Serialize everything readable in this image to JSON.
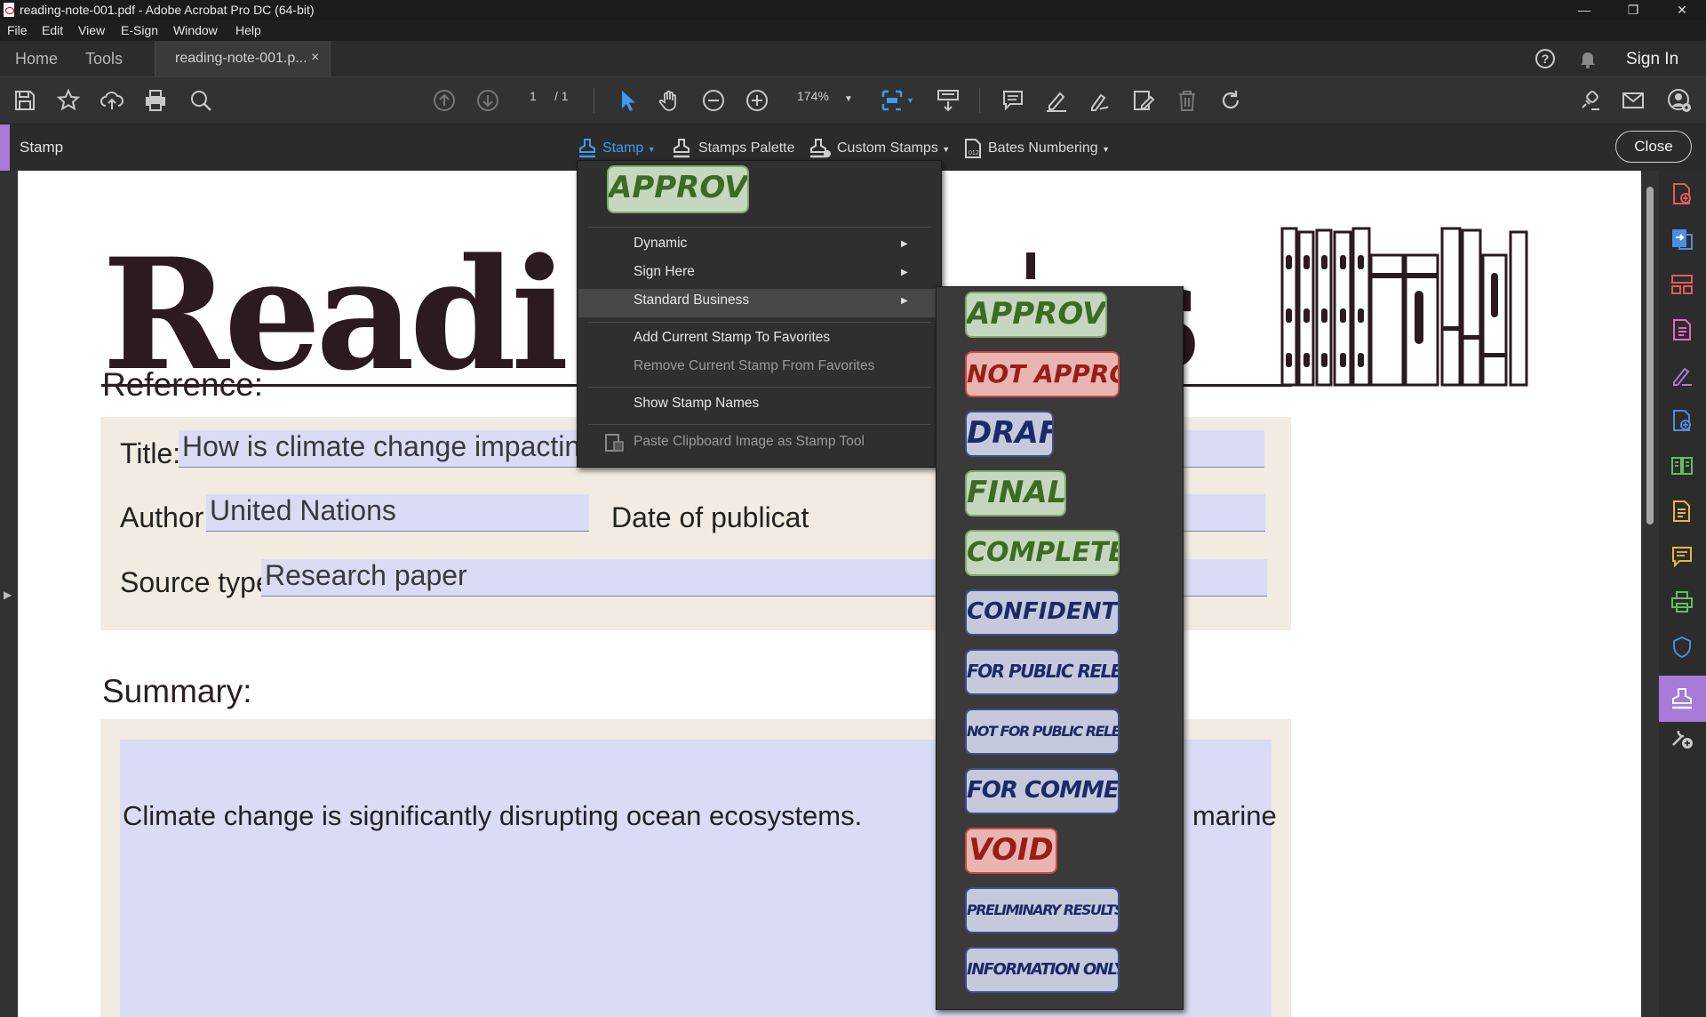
{
  "window": {
    "title": "reading-note-001.pdf - Adobe Acrobat Pro DC (64-bit)",
    "minimize": "—",
    "restore": "❐",
    "close": "✕"
  },
  "menubar": [
    "File",
    "Edit",
    "View",
    "E-Sign",
    "Window",
    "Help"
  ],
  "tabs": {
    "home": "Home",
    "tools": "Tools",
    "document": "reading-note-001.p...",
    "document_close": "×",
    "sign_in": "Sign In"
  },
  "toolbar": {
    "page_current": "1",
    "page_total": "/ 1",
    "zoom": "174%"
  },
  "stampbar": {
    "panel_name": "Stamp",
    "stamp_menu": "Stamp",
    "stamps_palette": "Stamps Palette",
    "custom_stamps": "Custom Stamps",
    "bates_numbering": "Bates Numbering",
    "close": "Close"
  },
  "stamp_menu": {
    "preview_stamp": "APPROVED",
    "items": [
      "Dynamic",
      "Sign Here",
      "Standard Business",
      "Add Current Stamp To Favorites",
      "Remove Current Stamp From Favorites",
      "Show Stamp Names",
      "Paste Clipboard Image as Stamp Tool"
    ],
    "highlighted": "Standard Business"
  },
  "standard_business_stamps": [
    {
      "label": "APPROVED",
      "color": "green"
    },
    {
      "label": "NOT APPROVED",
      "color": "red"
    },
    {
      "label": "DRAFT",
      "color": "blue"
    },
    {
      "label": "FINAL",
      "color": "green"
    },
    {
      "label": "COMPLETED",
      "color": "green"
    },
    {
      "label": "CONFIDENTIAL",
      "color": "blue"
    },
    {
      "label": "FOR PUBLIC RELEASE",
      "color": "blue"
    },
    {
      "label": "NOT FOR PUBLIC RELEASE",
      "color": "blue"
    },
    {
      "label": "FOR COMMENT",
      "color": "blue"
    },
    {
      "label": "VOID",
      "color": "red"
    },
    {
      "label": "PRELIMINARY RESULTS",
      "color": "blue"
    },
    {
      "label": "INFORMATION ONLY",
      "color": "blue"
    }
  ],
  "document": {
    "heading_left": "Readi",
    "heading_right": "s",
    "reference_title": "Reference:",
    "title_label": "Title:",
    "title_value": "How is climate change impacting the world's ocean",
    "author_label": "Author:",
    "author_value": "United Nations",
    "date_label": "Date of publicat",
    "source_label": "Source type:",
    "source_value": "Research paper",
    "summary_title": "Summary:",
    "summary_left": "Climate change is significantly disrupting ocean ecosystems.",
    "summary_right": "peratures threaten marine"
  },
  "colors": {
    "accent": "#a87bd8",
    "menu_bg": "#2f2f2f",
    "page_bg": "#ffffff",
    "beige": "#f1ebe1",
    "field": "#d9dcf4",
    "heading": "#2b1a20"
  }
}
